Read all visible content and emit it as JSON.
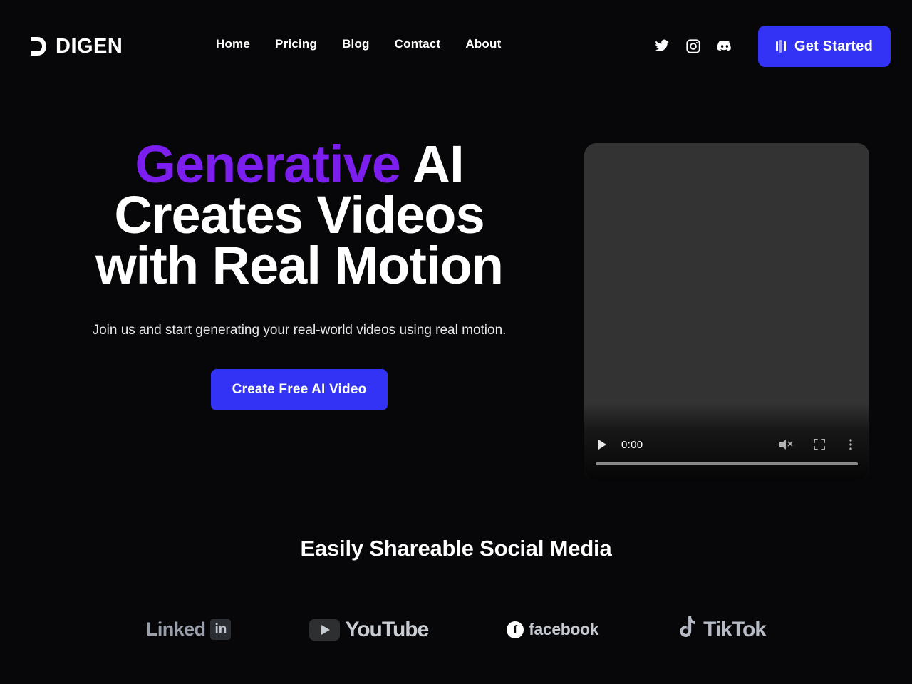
{
  "brand": {
    "name": "DIGEN",
    "logo_icon": "digen-d-mark-icon"
  },
  "colors": {
    "background": "#070709",
    "accent_purple": "#7c1fee",
    "accent_blue": "#3333f5",
    "video_surface": "#333333",
    "muted_text": "#9aa0ab"
  },
  "nav": {
    "items": [
      {
        "label": "Home"
      },
      {
        "label": "Pricing"
      },
      {
        "label": "Blog"
      },
      {
        "label": "Contact"
      },
      {
        "label": "About"
      }
    ]
  },
  "header": {
    "social": [
      {
        "icon": "twitter-icon",
        "name": "Twitter"
      },
      {
        "icon": "instagram-icon",
        "name": "Instagram"
      },
      {
        "icon": "discord-icon",
        "name": "Discord"
      }
    ],
    "cta": {
      "label": "Get Started",
      "icon": "equalizer-bars-icon"
    }
  },
  "hero": {
    "title_accent": "Generative",
    "title_rest_line1": " AI",
    "title_line2": "Creates Videos",
    "title_line3": "with Real Motion",
    "subtitle": "Join us and start generating your real-world videos using real motion.",
    "cta_label": "Create Free AI Video"
  },
  "video": {
    "current_time": "0:00",
    "progress_percent": 0,
    "controls": {
      "play": "play-icon",
      "volume": "volume-muted-icon",
      "fullscreen": "fullscreen-icon",
      "more": "more-options-icon"
    }
  },
  "social_section": {
    "heading": "Easily Shareable Social Media",
    "brands": [
      {
        "name": "LinkedIn",
        "label": "Linked",
        "badge": "in",
        "icon": "linkedin-icon"
      },
      {
        "name": "YouTube",
        "label": "YouTube",
        "icon": "youtube-icon"
      },
      {
        "name": "Facebook",
        "label": "facebook",
        "badge": "f",
        "icon": "facebook-icon"
      },
      {
        "name": "TikTok",
        "label": "TikTok",
        "icon": "tiktok-icon"
      }
    ]
  }
}
